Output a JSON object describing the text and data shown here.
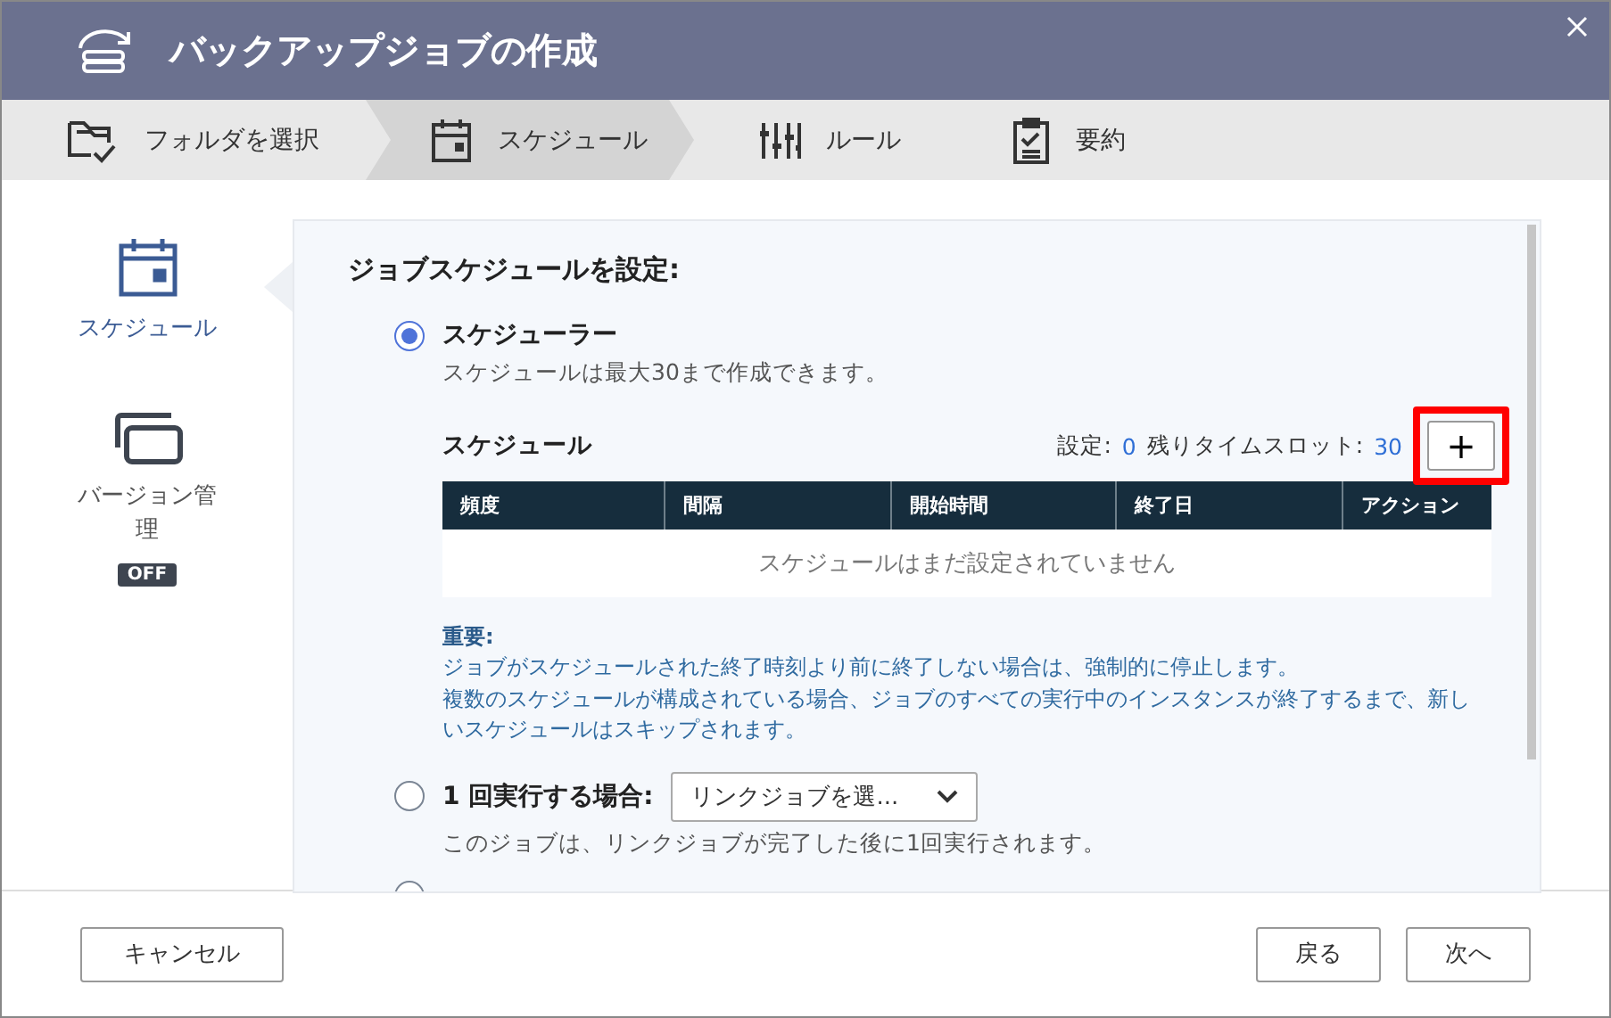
{
  "window": {
    "title": "バックアップジョブの作成"
  },
  "steps": [
    {
      "label": "フォルダを選択",
      "selected": false
    },
    {
      "label": "スケジュール",
      "selected": true
    },
    {
      "label": "ルール",
      "selected": false
    },
    {
      "label": "要約",
      "selected": false
    }
  ],
  "sidebar": {
    "items": [
      {
        "label": "スケジュール",
        "selected": true
      },
      {
        "label": "バージョン管理",
        "selected": false,
        "badge": "OFF"
      }
    ]
  },
  "panel": {
    "heading": "ジョブスケジュールを設定:",
    "options": [
      {
        "kind": "scheduler",
        "label": "スケジューラー",
        "selected": true,
        "description": "スケジュールは最大30まで作成できます。"
      },
      {
        "kind": "once",
        "label": "1 回実行する場合:",
        "selected": false,
        "dropdown": "リンクジョブを選...",
        "description": "このジョブは、リンクジョブが完了した後に1回実行されます。"
      },
      {
        "kind": "cut",
        "selected": false
      }
    ],
    "schedule": {
      "title": "スケジュール",
      "set_label": "設定:",
      "set_value": "0",
      "remaining_label": "残りタイムスロット:",
      "remaining_value": "30",
      "add_button": "+",
      "add_highlighted": true,
      "columns": [
        "頻度",
        "間隔",
        "開始時間",
        "終了日",
        "アクション"
      ],
      "empty": "スケジュールはまだ設定されていません"
    },
    "note": {
      "title": "重要:",
      "lines": [
        "ジョブがスケジュールされた終了時刻より前に終了しない場合は、強制的に停止します。",
        "複数のスケジュールが構成されている場合、ジョブのすべての実行中のインスタンスが終了するまで、新しいスケジュールはスキップされます。"
      ]
    }
  },
  "buttons": {
    "cancel": "キャンセル",
    "back": "戻る",
    "next": "次へ"
  }
}
